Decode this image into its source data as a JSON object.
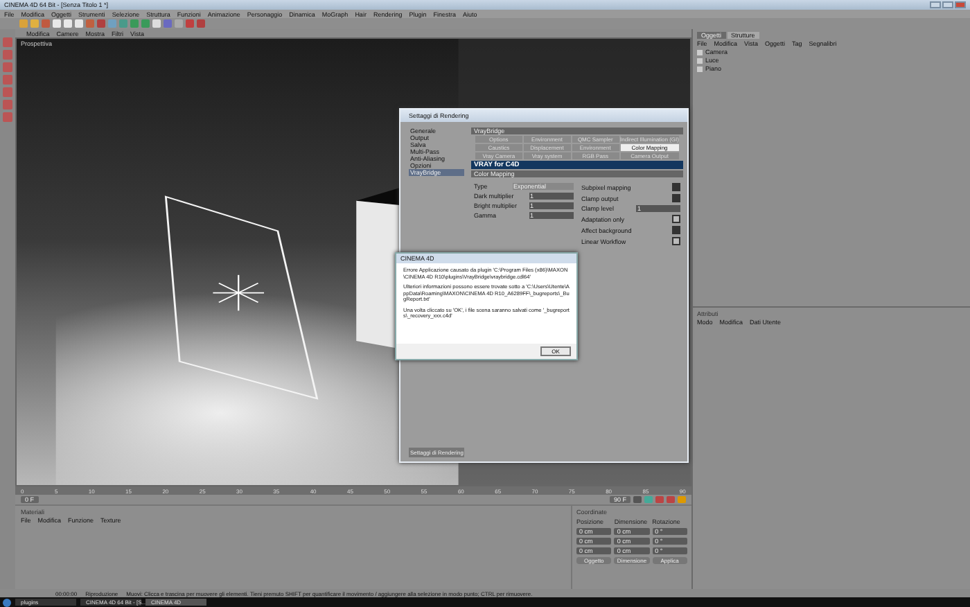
{
  "window": {
    "title": "CINEMA 4D 64 Bit - [Senza Titolo 1 *]"
  },
  "menu": [
    "File",
    "Modifica",
    "Oggetti",
    "Strumenti",
    "Selezione",
    "Struttura",
    "Funzioni",
    "Animazione",
    "Personaggio",
    "Dinamica",
    "MoGraph",
    "Hair",
    "Rendering",
    "Plugin",
    "Finestra",
    "Aiuto"
  ],
  "viewport": {
    "menu": [
      "Modifica",
      "Camere",
      "Mostra",
      "Filtri",
      "Vista"
    ],
    "label": "Prospettiva"
  },
  "object_manager": {
    "tabs": [
      {
        "label": "Oggetti",
        "selected": true
      },
      {
        "label": "Strutture",
        "selected": false
      }
    ],
    "menu": [
      "File",
      "Modifica",
      "Vista",
      "Oggetti",
      "Tag",
      "Segnalibri"
    ],
    "objects": [
      {
        "name": "Camera"
      },
      {
        "name": "Luce"
      },
      {
        "name": "Piano"
      }
    ]
  },
  "attributes": {
    "title": "Attributi",
    "menu": [
      "Modo",
      "Modifica",
      "Dati Utente"
    ]
  },
  "render_settings": {
    "title": "Settaggi di Rendering",
    "sections": [
      {
        "label": "Generale",
        "selected": false
      },
      {
        "label": "Output",
        "selected": false
      },
      {
        "label": "Salva",
        "selected": false
      },
      {
        "label": "Multi-Pass",
        "selected": false
      },
      {
        "label": "Anti-Aliasing",
        "selected": false
      },
      {
        "label": "Opzioni",
        "selected": false
      },
      {
        "label": "VrayBridge",
        "selected": true
      }
    ],
    "header": "VrayBridge",
    "tabs": [
      {
        "label": "Options",
        "selected": false
      },
      {
        "label": "Environment",
        "selected": false
      },
      {
        "label": "QMC Sampler",
        "selected": false
      },
      {
        "label": "Indirect Illumination (GI)",
        "selected": false
      },
      {
        "label": "Caustics",
        "selected": false
      },
      {
        "label": "Displacement",
        "selected": false
      },
      {
        "label": "Environment",
        "selected": false
      },
      {
        "label": "Color Mapping",
        "selected": true
      },
      {
        "label": "Vray Camera",
        "selected": false
      },
      {
        "label": "Vray system",
        "selected": false
      },
      {
        "label": "RGB Pass",
        "selected": false
      },
      {
        "label": "Camera Output",
        "selected": false
      }
    ],
    "banner": "VRAY for C4D",
    "section": "Color Mapping",
    "fields": [
      {
        "label": "Type",
        "value": "Exponential",
        "kind": "dropdown"
      },
      {
        "label": "Dark multiplier",
        "value": "1",
        "kind": "number"
      },
      {
        "label": "Bright multiplier",
        "value": "1",
        "kind": "number"
      },
      {
        "label": "Gamma",
        "value": "1",
        "kind": "number"
      }
    ],
    "options": [
      {
        "label": "Subpixel mapping",
        "kind": "checkbox",
        "checked": true
      },
      {
        "label": "Clamp output",
        "kind": "checkbox",
        "checked": true
      },
      {
        "label": "Clamp level",
        "kind": "number",
        "value": "1"
      },
      {
        "label": "Adaptation only",
        "kind": "checkbox",
        "checked": false
      },
      {
        "label": "Affect background",
        "kind": "checkbox",
        "checked": true
      },
      {
        "label": "Linear Workflow",
        "kind": "checkbox",
        "checked": false
      }
    ],
    "footer_button": "Settaggi di Rendering"
  },
  "error_dialog": {
    "title": "CINEMA 4D",
    "paragraphs": [
      "Errore Applicazione causato da plugin 'C:\\Program Files (x86)\\MAXON\\CINEMA 4D R10\\plugins\\VrayBridge\\vraybridge.cdl64'",
      "Ulteriori informazioni possono essere trovate sotto a 'C:\\Users\\Utente\\AppData\\Roaming\\MAXON\\CINEMA 4D R10_A6289FF\\_bugreports\\_BugReport.txt'",
      "Una volta cliccato su 'OK', i file scena saranno salvati come '_bugreports\\_recovery_xxx.c4d'"
    ],
    "button": "OK"
  },
  "timeline": {
    "ticks": [
      "0",
      "5",
      "10",
      "15",
      "20",
      "25",
      "30",
      "35",
      "40",
      "45",
      "50",
      "55",
      "60",
      "65",
      "70",
      "75",
      "80",
      "85",
      "90"
    ],
    "frame_field": "0 F",
    "end_field": "90 F"
  },
  "materials": {
    "title": "Materiali",
    "menu": [
      "File",
      "Modifica",
      "Funzione",
      "Texture"
    ]
  },
  "coordinates": {
    "title": "Coordinate",
    "columns": [
      "Posizione",
      "Dimensione",
      "Rotazione"
    ],
    "rows": [
      {
        "values": [
          "0 cm",
          "0 cm",
          "0 °"
        ]
      },
      {
        "values": [
          "0 cm",
          "0 cm",
          "0 °"
        ]
      },
      {
        "values": [
          "0 cm",
          "0 cm",
          "0 °"
        ]
      }
    ],
    "buttons": [
      "Oggetto",
      "Dimensione",
      "Applica"
    ]
  },
  "status_bar": {
    "time": "00:00:00",
    "mode": "Riproduzione",
    "message": "Muovi: Clicca e trascina per muovere gli elementi. Tieni premuto SHIFT per quantificare il movimento / aggiungere alla selezione in modo punto; CTRL per rimuovere."
  },
  "taskbar": {
    "items": [
      {
        "label": "plugins",
        "selected": false
      },
      {
        "label": "CINEMA 4D 64 Bit - [S...",
        "selected": false
      },
      {
        "label": "CINEMA 4D",
        "selected": true
      }
    ]
  }
}
